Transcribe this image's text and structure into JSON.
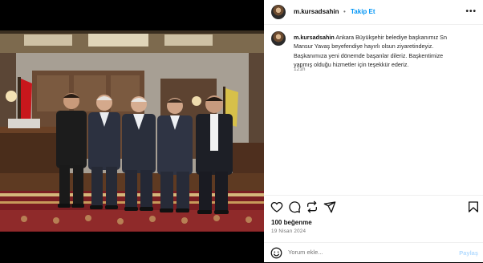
{
  "post": {
    "username": "m.kursadsahin",
    "separator": "•",
    "follow_label": "Takip Et",
    "more_label": "•••",
    "caption_text": "Ankara Büyükşehir belediye başkanımız Sn\nMansur Yavaş beyefendiye hayırlı olsun ziyaretindeyiz.\nBaşkanımıza yeni dönemde başarılar dileriz. Başkentimize\nyapmış olduğu hizmetler için teşekkür ederiz.",
    "age": "121h",
    "likes": "100 beğenme",
    "date": "19 Nisan 2024",
    "comment_placeholder": "Yorum ekle...",
    "share_label": "Paylaş"
  },
  "colors": {
    "accent": "#0095f6",
    "share_disabled": "#b3dbff",
    "secondary_text": "#737373"
  },
  "icons": [
    "heart-icon",
    "comment-icon",
    "repost-icon",
    "share-icon",
    "bookmark-icon",
    "emoji-icon"
  ]
}
